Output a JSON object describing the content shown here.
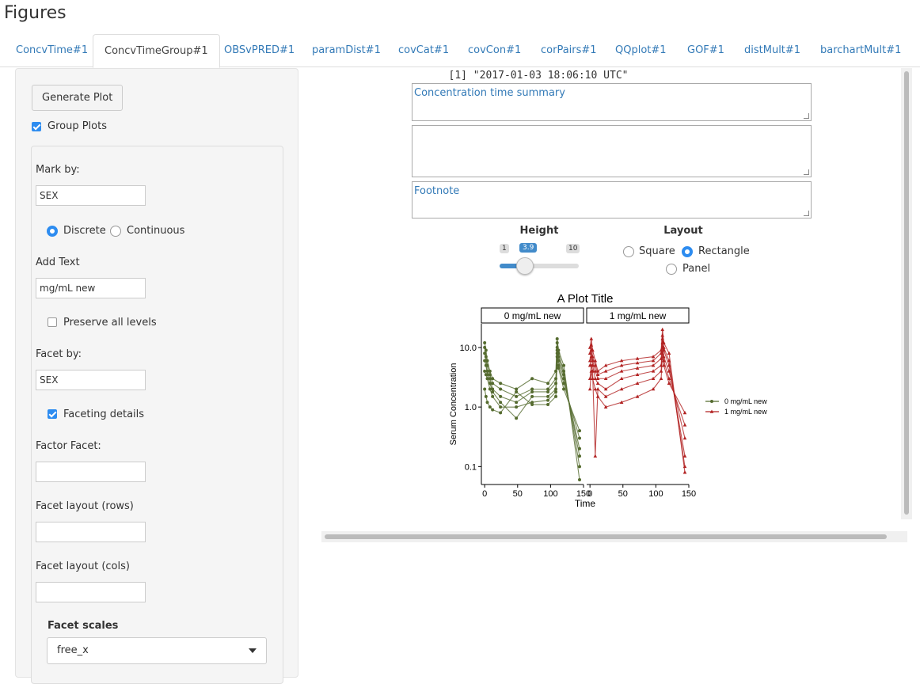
{
  "page_title": "Figures",
  "tabs": [
    {
      "label": "ConcvTime#1",
      "active": false
    },
    {
      "label": "ConcvTimeGroup#1",
      "active": true
    },
    {
      "label": "OBSvPRED#1",
      "active": false
    },
    {
      "label": "paramDist#1",
      "active": false
    },
    {
      "label": "covCat#1",
      "active": false
    },
    {
      "label": "covCon#1",
      "active": false
    },
    {
      "label": "corPairs#1",
      "active": false
    },
    {
      "label": "QQplot#1",
      "active": false
    },
    {
      "label": "GOF#1",
      "active": false
    },
    {
      "label": "distMult#1",
      "active": false
    },
    {
      "label": "barchartMult#1",
      "active": false
    }
  ],
  "sidebar": {
    "generate_button": "Generate Plot",
    "group_plots_label": "Group Plots",
    "group_plots_checked": true,
    "mark_by_label": "Mark by:",
    "mark_by_value": "SEX",
    "discrete_label": "Discrete",
    "continuous_label": "Continuous",
    "mark_mode": "Discrete",
    "add_text_label": "Add Text",
    "add_text_value": "mg/mL new",
    "preserve_levels_label": "Preserve all levels",
    "preserve_levels_checked": false,
    "facet_by_label": "Facet by:",
    "facet_by_value": "SEX",
    "faceting_details_label": "Faceting details",
    "faceting_details_checked": true,
    "factor_facet_label": "Factor Facet:",
    "factor_facet_value": "",
    "facet_rows_label": "Facet layout (rows)",
    "facet_rows_value": "",
    "facet_cols_label": "Facet layout (cols)",
    "facet_cols_value": "",
    "facet_scales_label": "Facet scales",
    "facet_scales_value": "free_x"
  },
  "main": {
    "timestamp": "[1] \"2017-01-03 18:06:10 UTC\"",
    "textarea1": "Concentration time summary",
    "textarea2": "",
    "textarea3": "Footnote",
    "height_label": "Height",
    "height_min": "1",
    "height_max": "10",
    "height_value": "3.9",
    "layout_label": "Layout",
    "layout_square": "Square",
    "layout_rectangle": "Rectangle",
    "layout_panel": "Panel",
    "layout_selected": "Rectangle"
  },
  "colors": {
    "group0": "#556b2f",
    "group1": "#b22222",
    "accent": "#2d8cf0"
  },
  "chart_data": {
    "type": "line",
    "title": "A Plot Title",
    "xlabel": "Time",
    "ylabel": "Serum Concentration",
    "y_scale": "log",
    "ylim": [
      0.05,
      25
    ],
    "y_ticks": [
      "0.1",
      "1.0",
      "10.0"
    ],
    "x_ticks": [
      "0",
      "50",
      "100",
      "150"
    ],
    "xlim": [
      -5,
      150
    ],
    "legend_placement": "right",
    "legend": [
      "0 mg/mL new",
      "1 mg/mL new"
    ],
    "facets": [
      {
        "label": "0 mg/mL new",
        "series": [
          {
            "x": [
              0,
              2,
              4,
              8,
              12,
              24,
              48,
              72,
              96,
              108,
              110,
              112,
              120,
              144
            ],
            "y": [
              12,
              9,
              6,
              4,
              3,
              2.5,
              2,
              3,
              2.5,
              4,
              14,
              9,
              5,
              0.06
            ]
          },
          {
            "x": [
              0,
              2,
              4,
              8,
              12,
              24,
              48,
              72,
              96,
              108,
              110,
              112,
              120,
              144
            ],
            "y": [
              10,
              7,
              5,
              3.5,
              2.5,
              2,
              1.5,
              2,
              2,
              3,
              12,
              8,
              4,
              0.1
            ]
          },
          {
            "x": [
              0,
              2,
              4,
              8,
              12,
              24,
              48,
              72,
              96,
              108,
              110,
              112,
              120,
              144
            ],
            "y": [
              8,
              6,
              4,
              3,
              2,
              1.5,
              1.2,
              1.8,
              1.8,
              2.5,
              10,
              7,
              3.5,
              0.15
            ]
          },
          {
            "x": [
              0,
              2,
              4,
              8,
              12,
              24,
              48,
              72,
              96,
              108,
              110,
              112,
              120,
              144
            ],
            "y": [
              6,
              5,
              3.5,
              2.5,
              1.8,
              1.2,
              0.65,
              1.5,
              1.5,
              2,
              9,
              6,
              3,
              0.2
            ]
          },
          {
            "x": [
              0,
              2,
              4,
              8,
              12,
              24,
              48,
              72,
              96,
              108,
              110,
              112,
              120,
              144
            ],
            "y": [
              4,
              3.5,
              3,
              2,
              1.5,
              1,
              1,
              1.2,
              1.3,
              1.8,
              8,
              5,
              2.5,
              0.3
            ]
          },
          {
            "x": [
              0,
              2,
              4,
              8,
              12,
              24,
              48,
              72,
              96,
              108,
              110,
              112,
              120,
              144
            ],
            "y": [
              2,
              1.5,
              1.2,
              1,
              0.9,
              0.8,
              1.8,
              1.1,
              1.1,
              1.5,
              7,
              4.5,
              2,
              0.4
            ]
          }
        ]
      },
      {
        "label": "1 mg/mL new",
        "series": [
          {
            "x": [
              0,
              2,
              4,
              8,
              12,
              24,
              48,
              72,
              96,
              108,
              110,
              112,
              120,
              144
            ],
            "y": [
              10,
              14,
              9,
              6,
              4,
              5,
              6,
              6.5,
              7,
              9,
              20,
              12,
              8,
              0.08
            ]
          },
          {
            "x": [
              0,
              2,
              4,
              8,
              12,
              24,
              48,
              72,
              96,
              108,
              110,
              112,
              120,
              144
            ],
            "y": [
              8,
              11,
              7,
              5,
              3.5,
              4,
              5,
              5.5,
              6,
              8,
              16,
              10,
              6,
              0.1
            ]
          },
          {
            "x": [
              0,
              2,
              4,
              8,
              12,
              24,
              48,
              72,
              96,
              108,
              110,
              112,
              120,
              144
            ],
            "y": [
              6,
              9,
              6,
              4,
              3,
              3,
              4,
              4.5,
              5,
              6.5,
              14,
              9,
              5,
              0.15
            ]
          },
          {
            "x": [
              0,
              2,
              4,
              8,
              12,
              24,
              48,
              72,
              96,
              108,
              110,
              112,
              120,
              144
            ],
            "y": [
              5,
              7,
              5,
              3,
              2.5,
              2,
              3,
              3.5,
              4,
              5,
              12,
              7,
              4,
              0.3
            ]
          },
          {
            "x": [
              0,
              2,
              4,
              8,
              12,
              24,
              48,
              72,
              96,
              108,
              110,
              112,
              120,
              144
            ],
            "y": [
              3,
              5,
              4,
              0.15,
              2,
              1.5,
              2,
              2.5,
              3,
              4,
              10,
              6,
              3,
              0.5
            ]
          },
          {
            "x": [
              0,
              2,
              4,
              8,
              12,
              24,
              48,
              72,
              96,
              108,
              110,
              112,
              120,
              144
            ],
            "y": [
              2,
              4,
              3,
              2,
              1.5,
              1,
              1.2,
              1.5,
              2,
              3,
              8,
              5,
              2.5,
              0.8
            ]
          }
        ]
      }
    ]
  }
}
